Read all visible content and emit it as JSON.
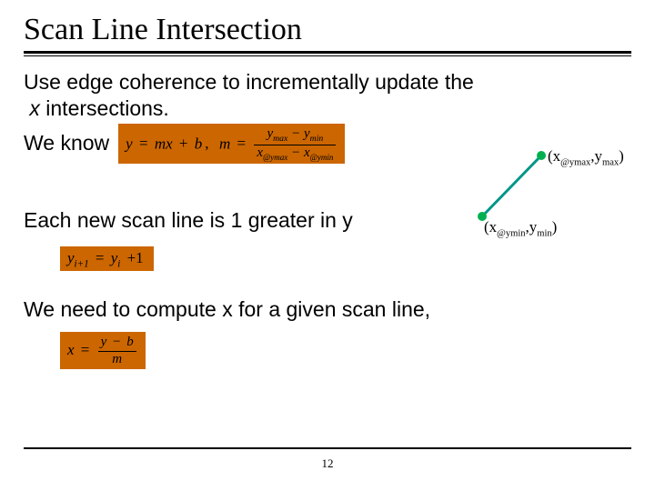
{
  "title": "Scan Line Intersection",
  "intro_line1": "Use edge coherence to incrementally update the",
  "intro_indent_it": "x",
  "intro_indent_rest": " intersections.",
  "we_know_label": "We know",
  "formula_main": {
    "lhs1": "y",
    "eq": "=",
    "rhs1a": "mx",
    "rhs1b": "+",
    "rhs1c": "b",
    "comma": ",",
    "lhs2": "m",
    "num_l": "y",
    "num_lsub": "max",
    "num_minus": " − ",
    "num_r": "y",
    "num_rsub": "min",
    "den_l": "x",
    "den_lsub": "@ymax",
    "den_minus": " − ",
    "den_r": "x",
    "den_rsub": "@ymin"
  },
  "label_top": {
    "open": "(x",
    "s1": "@ymax",
    "comma": ",y",
    "s2": "max",
    "close": ")"
  },
  "label_bot": {
    "open": "(x",
    "s1": "@ymin",
    "comma": ",y",
    "s2": "min",
    "close": ")"
  },
  "para_scanline": "Each new scan line is 1 greater in y",
  "formula_y": {
    "lhs": "y",
    "lsub": "i+1",
    "eq": " = ",
    "rhs": "y",
    "rsub": "i",
    "tail": " +1"
  },
  "para_need": "We need to compute x for a given scan line,",
  "formula_x": {
    "lhs": "x",
    "eq": " = ",
    "num_l": "y",
    "num_m": " − ",
    "num_r": "b",
    "den": "m"
  },
  "page_number": "12"
}
